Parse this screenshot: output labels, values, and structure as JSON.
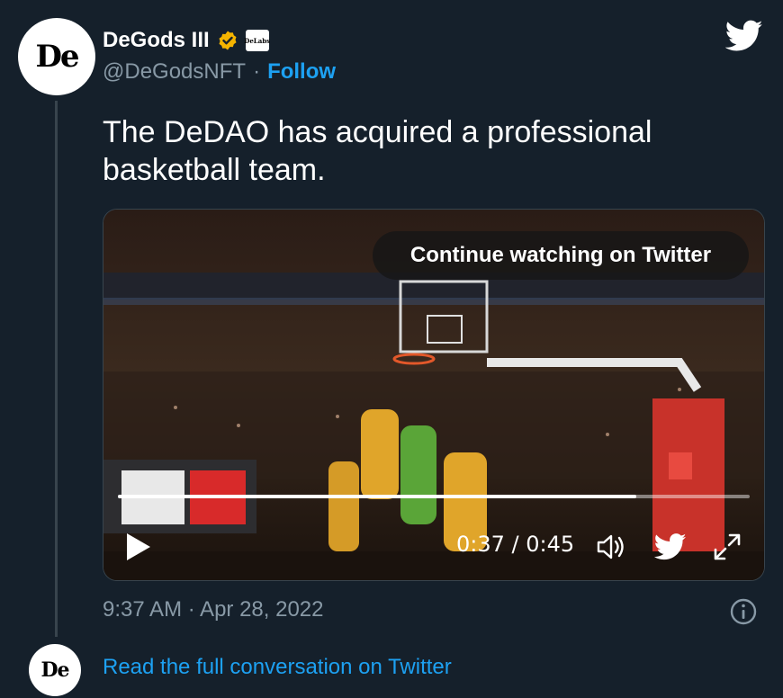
{
  "tweet": {
    "author": {
      "display_name": "DeGods III",
      "handle": "@DeGodsNFT",
      "avatar_text": "De",
      "affiliate_badge_text": "DeLabs"
    },
    "follow_label": "Follow",
    "separator": "·",
    "text": "The DeDAO has acquired a professional basketball team.",
    "timestamp": "9:37 AM · Apr 28, 2022",
    "read_full_label": "Read the full conversation on Twitter"
  },
  "video": {
    "continue_label": "Continue watching on Twitter",
    "time_display": "0:37 / 0:45",
    "progress": 0.82,
    "icons": [
      "play-icon",
      "volume-icon",
      "twitter-bird-icon",
      "expand-icon"
    ]
  },
  "colors": {
    "background": "#15202b",
    "accent": "#1da1f2",
    "secondary_text": "#8899a6",
    "verified_badge": "#f4b400"
  }
}
